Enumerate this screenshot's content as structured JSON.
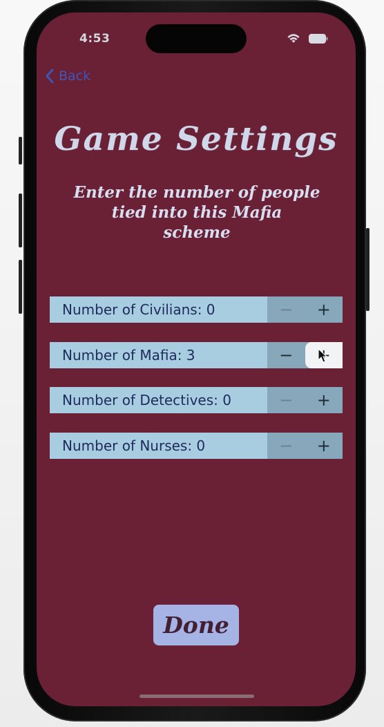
{
  "status_bar": {
    "time": "4:53",
    "wifi_icon": "wifi-icon",
    "battery_icon": "battery-icon"
  },
  "nav": {
    "back_label": "Back",
    "back_icon": "chevron-left-icon"
  },
  "header": {
    "title": "Game Settings",
    "subtitle_lines": [
      "Enter the number of people",
      "tied into this Mafia",
      "scheme"
    ]
  },
  "settings": [
    {
      "label": "Number of Civilians: 0",
      "minus": "−",
      "plus": "+"
    },
    {
      "label": "Number of Mafia: 3",
      "minus": "−",
      "plus": "+"
    },
    {
      "label": "Number of Detectives: 0",
      "minus": "−",
      "plus": "+"
    },
    {
      "label": "Number of Nurses: 0",
      "minus": "−",
      "plus": "+"
    }
  ],
  "actions": {
    "done_label": "Done"
  },
  "colors": {
    "screen_background": "#6a2035",
    "row_background": "#a8cde0",
    "stepper_background": "#87a8bb",
    "title_text": "#cfd8ea",
    "back_link": "#3f56b8",
    "done_button": "#a5b4e4"
  }
}
